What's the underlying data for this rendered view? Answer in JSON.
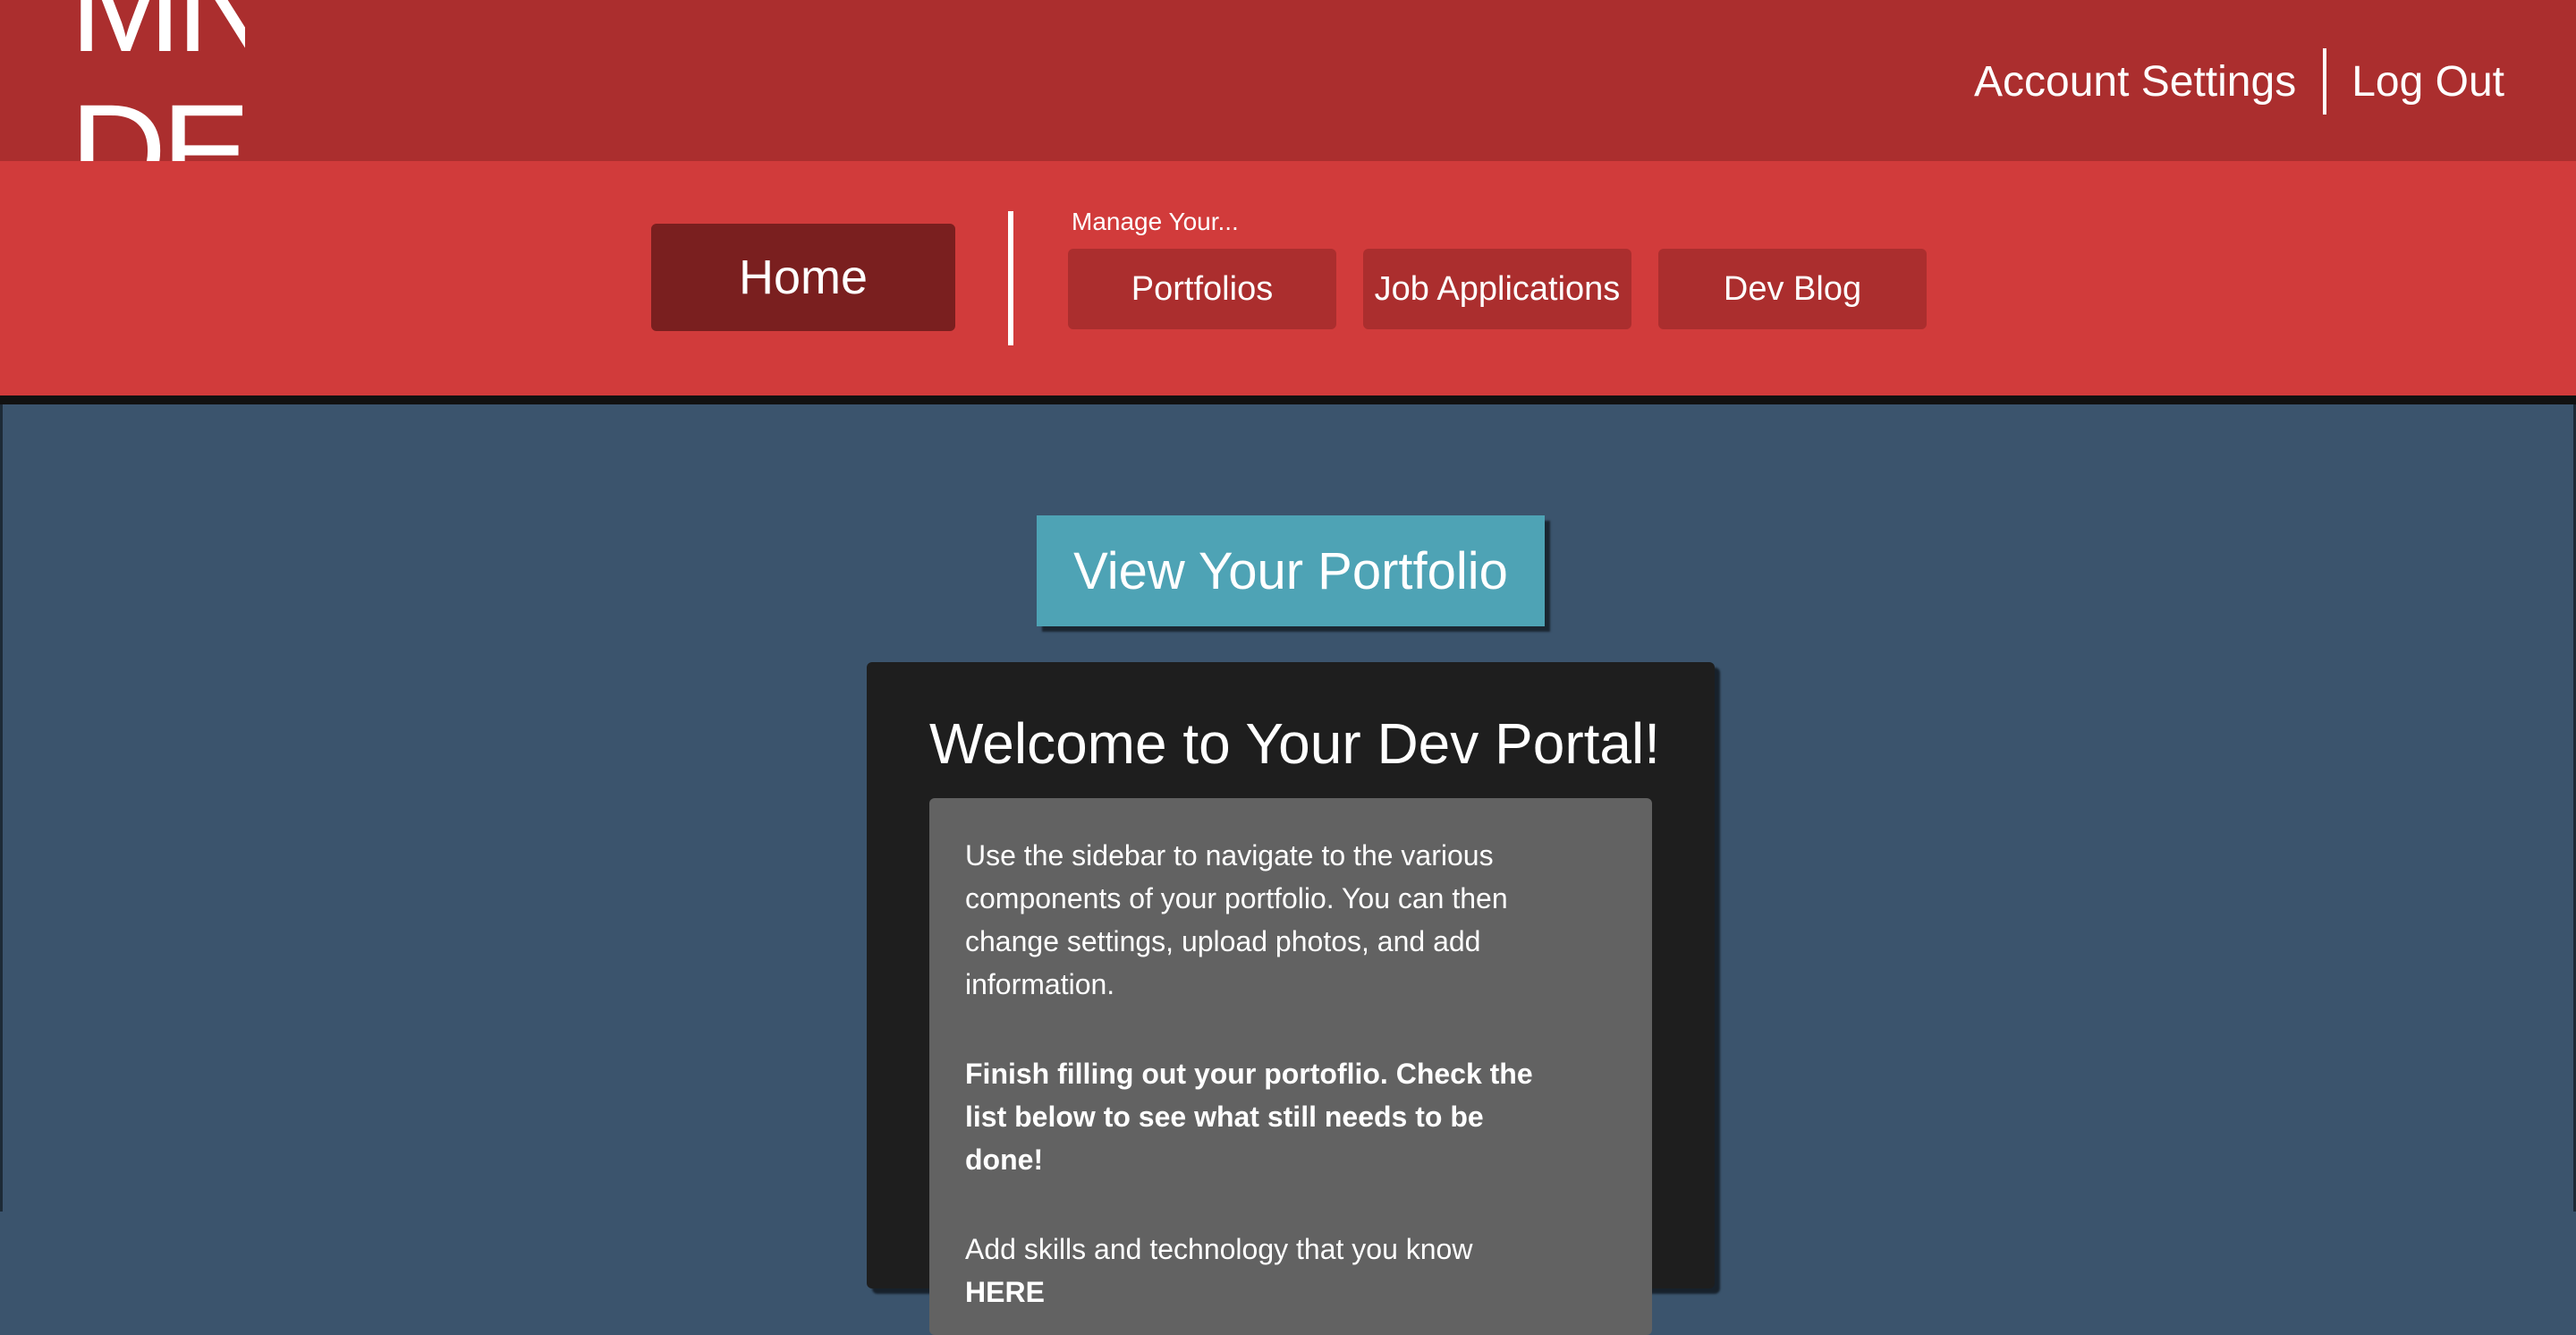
{
  "header": {
    "logo_line1": "MN",
    "logo_line2": "DE",
    "account_settings_label": "Account Settings",
    "logout_label": "Log Out"
  },
  "nav": {
    "home_label": "Home",
    "manage_label": "Manage Your...",
    "items": [
      {
        "label": "Portfolios"
      },
      {
        "label": "Job Applications"
      },
      {
        "label": "Dev Blog"
      }
    ]
  },
  "main": {
    "view_portfolio_label": "View Your Portfolio",
    "welcome_title": "Welcome to Your Dev Portal!",
    "intro_text": "Use the sidebar to navigate to the various components of your portfolio. You can then change settings, upload photos, and add information.",
    "finish_text": "Finish filling out your portoflio. Check the list below to see what still needs to be done!",
    "skills_text": "Add skills and technology that you know ",
    "skills_link": "HERE"
  },
  "colors": {
    "topbar": "#ab2e2e",
    "navbar": "#d13b3b",
    "home_button": "#7a1f1f",
    "main_background": "#3b546d",
    "view_button": "#4ea3b5",
    "card": "#1e1e1e",
    "card_body": "#626262"
  }
}
